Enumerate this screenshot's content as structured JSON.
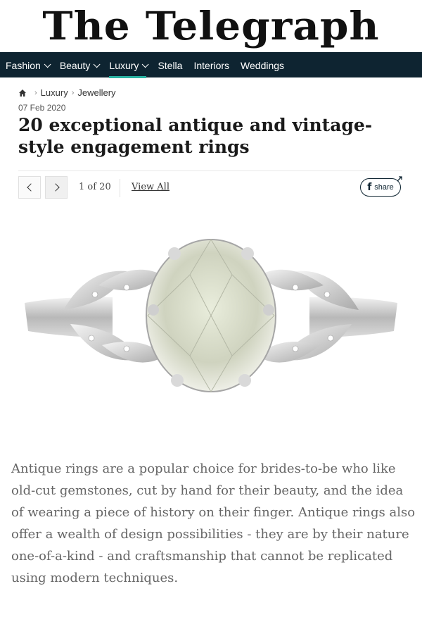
{
  "masthead": {
    "logo_text": "The Telegraph"
  },
  "nav": {
    "items": [
      {
        "label": "Fashion",
        "has_dropdown": true
      },
      {
        "label": "Beauty",
        "has_dropdown": true
      },
      {
        "label": "Luxury",
        "has_dropdown": true,
        "active": true
      },
      {
        "label": "Stella",
        "has_dropdown": false
      },
      {
        "label": "Interiors",
        "has_dropdown": false
      },
      {
        "label": "Weddings",
        "has_dropdown": false
      }
    ],
    "active_accent": "#2bb3a3",
    "background": "#0e2431"
  },
  "breadcrumb": {
    "home_icon": "home-icon",
    "items": [
      "Luxury",
      "Jewellery"
    ]
  },
  "article": {
    "date": "07 Feb 2020",
    "title": "20 exceptional antique and vintage-style engagement rings"
  },
  "gallery": {
    "counter": "1 of 20",
    "view_all_label": "View All",
    "share_label": "share",
    "share_icon": "facebook-icon",
    "caption": "Antique rings are a popular choice for brides-to-be who like old-cut gemstones, cut by hand for their beauty, and the idea of wearing a piece of history on their finger. Antique rings also offer a wealth of design possibilities - they are by their nature one-of-a-kind - and craftsmanship that cannot be replicated using modern techniques."
  }
}
